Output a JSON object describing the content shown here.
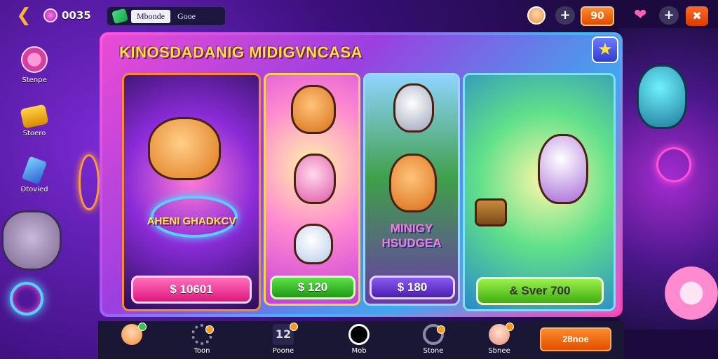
{
  "topbar": {
    "coins": "0035",
    "tabs": [
      {
        "label": "Mbonde"
      },
      {
        "label": "Gooe"
      }
    ],
    "score": "90"
  },
  "sidebar": {
    "items": [
      {
        "label": "Stenpe",
        "icon": "medal-icon"
      },
      {
        "label": "Stoero",
        "icon": "crate-icon"
      },
      {
        "label": "Dtovied",
        "icon": "crystal-icon"
      }
    ]
  },
  "panel": {
    "title": "KINOSDADANIG MIDIGVNCASA"
  },
  "cards": [
    {
      "caption": "AHENI GHADKCV",
      "price": "$ 10601",
      "price_color": "#ff3fa6"
    },
    {
      "caption": "",
      "price": "$ 120",
      "price_color": "#3fbf2a"
    },
    {
      "caption": "MINIGY HSUDGEA",
      "price": "$ 180",
      "price_color": "#7a3bd9"
    },
    {
      "caption": "",
      "price": "& Sver 700",
      "price_color": "#6fd92a"
    }
  ],
  "bottom_nav": {
    "items": [
      {
        "label": "",
        "icon": "avatar-icon"
      },
      {
        "label": "Toon",
        "icon": "gear-icon"
      },
      {
        "label": "Poone",
        "icon": "number-icon"
      },
      {
        "label": "Mob",
        "icon": "timer-icon"
      },
      {
        "label": "Stone",
        "icon": "shield-icon"
      },
      {
        "label": "Sbnee",
        "icon": "face-icon"
      }
    ],
    "action_label": "28noe"
  }
}
